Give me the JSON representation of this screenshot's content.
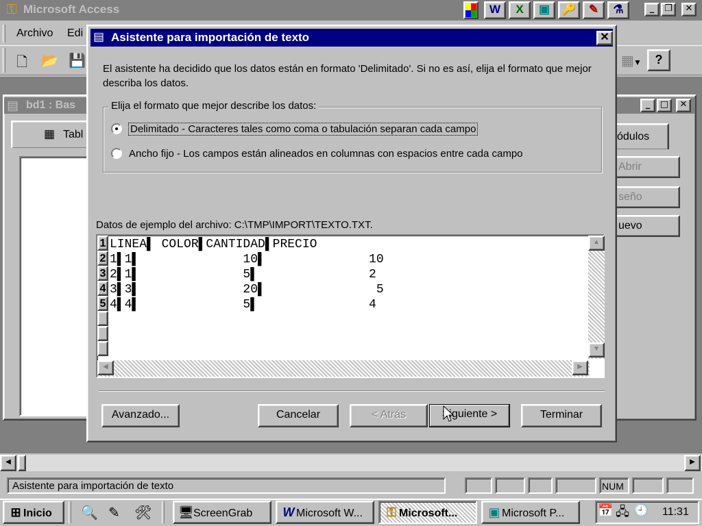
{
  "app": {
    "title": "Microsoft Access",
    "menu": [
      "Archivo",
      "Edi"
    ],
    "office_bar": [
      "W",
      "X",
      "▣",
      "🔑",
      "✎",
      "⚗"
    ]
  },
  "db_window": {
    "title": "bd1 : Bas",
    "tab_tables": "Tabl",
    "tab_modules": "ódulos",
    "btn_open": "Abrir",
    "btn_design": "seño",
    "btn_new": "uevo"
  },
  "dialog": {
    "title": "Asistente para importación de texto",
    "intro": "El asistente ha decidido que los datos están en formato 'Delimitado'. Si no es así, elija el formato que mejor describa los datos.",
    "group_label": "Elija el formato que mejor describe los datos:",
    "options": [
      {
        "label": "Delimitado - Caracteres tales como coma o tabulación separan cada campo",
        "checked": true
      },
      {
        "label": "Ancho fijo - Los campos están alineados en columnas con espacios entre cada campo",
        "checked": false
      }
    ],
    "sample_label": "Datos de ejemplo del archivo: C:\\TMP\\IMPORT\\TEXTO.TXT.",
    "sample_rows": [
      "LINEA▌ COLOR▌CANTIDAD▌PRECIO",
      "1▌1▌              10▌              10",
      "2▌1▌              5▌               2",
      "3▌3▌              20▌               5",
      "4▌4▌              5▌               4"
    ],
    "row_numbers": [
      "1",
      "2",
      "3",
      "4",
      "5"
    ],
    "buttons": {
      "advanced": "Avanzado...",
      "cancel": "Cancelar",
      "back": "< Atrás",
      "next": "Siguiente >",
      "finish": "Terminar"
    }
  },
  "status": {
    "text": "Asistente para importación de texto",
    "num": "NUM"
  },
  "taskbar": {
    "start": "Inicio",
    "tasks": [
      "ScreenGrab",
      "Microsoft W...",
      "Microsoft...",
      "Microsoft P..."
    ],
    "clock": "11:31"
  }
}
